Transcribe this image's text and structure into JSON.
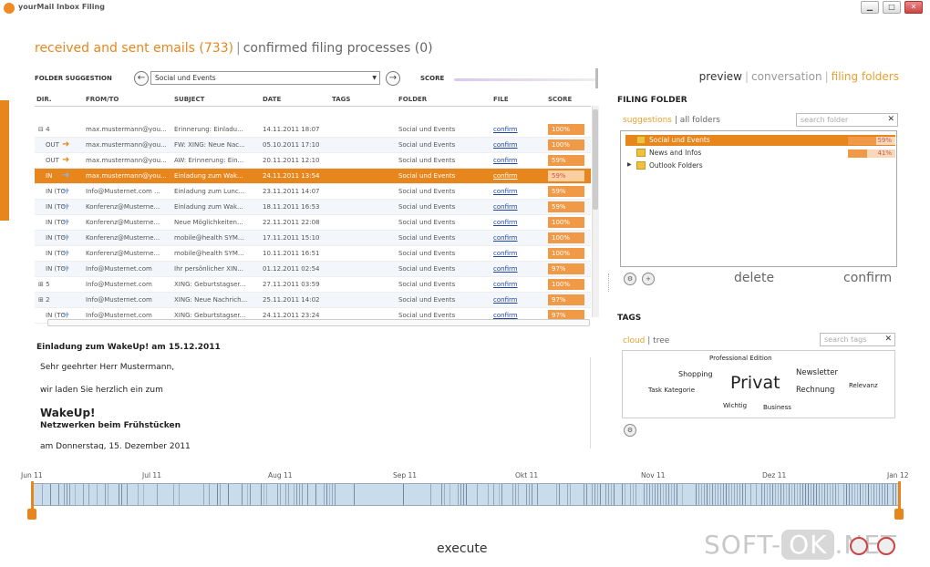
{
  "window": {
    "title": "yourMail Inbox Filing",
    "min": "▁",
    "max": "□",
    "close": "✕"
  },
  "header": {
    "received": "received and sent emails (733)",
    "sep": "|",
    "processes": "confirmed filing processes (0)"
  },
  "folder_suggestion": {
    "label": "FOLDER SUGGESTION",
    "value": "Social und Events",
    "score_label": "SCORE"
  },
  "right_tabs": {
    "preview": "preview",
    "conversation": "conversation",
    "filing": "filing folders",
    "sep": "|"
  },
  "table": {
    "headers": [
      "DIR.",
      "FROM/TO",
      "SUBJECT",
      "DATE",
      "TAGS",
      "FOLDER",
      "FILE",
      "SCORE"
    ],
    "rows": [
      {
        "dir": "⊟ 4",
        "from": "max.mustermann@you...",
        "subject": "Erinnerung: Einladu...",
        "date": "14.11.2011 18:07",
        "folder": "Social und Events",
        "file": "confirm",
        "score": "100%",
        "style": ""
      },
      {
        "dir": "OUT",
        "from": "max.mustermann@you...",
        "subject": "FW: XING: Neue Nac...",
        "date": "05.10.2011 17:10",
        "folder": "Social und Events",
        "file": "confirm",
        "score": "100%",
        "style": "alt"
      },
      {
        "dir": "OUT",
        "from": "max.mustermann@you...",
        "subject": "AW: Erinnerung: Ein...",
        "date": "20.11.2011 12:10",
        "folder": "Social und Events",
        "file": "confirm",
        "score": "59%",
        "style": ""
      },
      {
        "dir": "IN",
        "from": "max.mustermann@you...",
        "subject": "Einladung zum Wak...",
        "date": "24.11.2011 13:54",
        "folder": "Social und Events",
        "file": "confirm",
        "score": "59%",
        "style": "sel"
      },
      {
        "dir": "IN (TO)",
        "from": "Info@Musternet.com ...",
        "subject": "Einladung zum Lunc...",
        "date": "23.11.2011 14:07",
        "folder": "Social und Events",
        "file": "confirm",
        "score": "59%",
        "style": ""
      },
      {
        "dir": "IN (TO)",
        "from": "Konferenz@Musterne...",
        "subject": "Einladung zum Wak...",
        "date": "18.11.2011 16:53",
        "folder": "Social und Events",
        "file": "confirm",
        "score": "59%",
        "style": "alt"
      },
      {
        "dir": "IN (TO)",
        "from": "Konferenz@Musterne...",
        "subject": "Neue Möglichkeiten...",
        "date": "22.11.2011 22:08",
        "folder": "Social und Events",
        "file": "confirm",
        "score": "100%",
        "style": ""
      },
      {
        "dir": "IN (TO)",
        "from": "Konferenz@Musterne...",
        "subject": "mobile@health SYM...",
        "date": "17.11.2011 15:10",
        "folder": "Social und Events",
        "file": "confirm",
        "score": "100%",
        "style": "alt"
      },
      {
        "dir": "IN (TO)",
        "from": "Konferenz@Musterne...",
        "subject": "mobile@health SYM...",
        "date": "10.11.2011 16:51",
        "folder": "Social und Events",
        "file": "confirm",
        "score": "100%",
        "style": ""
      },
      {
        "dir": "IN (TO)",
        "from": "Info@Musternet.com",
        "subject": "Ihr persönlicher XIN...",
        "date": "01.12.2011 02:54",
        "folder": "Social und Events",
        "file": "confirm",
        "score": "97%",
        "style": "alt"
      },
      {
        "dir": "⊞ 5",
        "from": "Info@Musternet.com",
        "subject": "XING: Geburtstagser...",
        "date": "27.11.2011 03:59",
        "folder": "Social und Events",
        "file": "confirm",
        "score": "100%",
        "style": ""
      },
      {
        "dir": "⊞ 2",
        "from": "Info@Musternet.com",
        "subject": "XING: Neue Nachrich...",
        "date": "25.11.2011 14:02",
        "folder": "Social und Events",
        "file": "confirm",
        "score": "97%",
        "style": "alt"
      },
      {
        "dir": "IN (TO)",
        "from": "Info@Musternet.com",
        "subject": "XING: Geburtstagser...",
        "date": "24.11.2011 23:24",
        "folder": "Social und Events",
        "file": "confirm",
        "score": "97%",
        "style": ""
      }
    ]
  },
  "preview": {
    "title": "Einladung zum WakeUp! am 15.12.2011",
    "l1": "Sehr geehrter Herr Mustermann,",
    "l2": "wir laden Sie herzlich ein zum",
    "l3": "WakeUp!",
    "l4": "Netzwerken beim Frühstücken",
    "l5": "am Donnerstag, 15. Dezember 2011"
  },
  "filing": {
    "title": "FILING FOLDER",
    "tab_suggestions": "suggestions",
    "sep": "|",
    "tab_all": "all folders",
    "search_placeholder": "search folder",
    "folders": [
      {
        "name": "Social und Events",
        "pct": "59%",
        "value": 0.59
      },
      {
        "name": "News and Infos",
        "pct": "41%",
        "value": 0.41
      },
      {
        "name": "Outlook Folders"
      }
    ],
    "delete": "delete",
    "confirm": "confirm"
  },
  "tags": {
    "title": "TAGS",
    "tab_cloud": "cloud",
    "sep": "|",
    "tab_tree": "tree",
    "search_placeholder": "search tags",
    "items": {
      "pro": "Professional Edition",
      "shopping": "Shopping",
      "privat": "Privat",
      "newsletter": "Newsletter",
      "rechnung": "Rechnung",
      "relevanz": "Relevanz",
      "task": "Task Kategorie",
      "wichtig": "Wichtig",
      "business": "Business"
    }
  },
  "timeline": {
    "labels": [
      "Jun 11",
      "Jul 11",
      "Aug 11",
      "Sep 11",
      "Okt 11",
      "Nov 11",
      "Dez 11",
      "Jan 12"
    ]
  },
  "execute": "execute",
  "watermark": {
    "a": "SOFT-",
    "b": "OK",
    "c": ".NET"
  },
  "colors": {
    "accent": "#e8861e",
    "link": "#2246a0"
  }
}
